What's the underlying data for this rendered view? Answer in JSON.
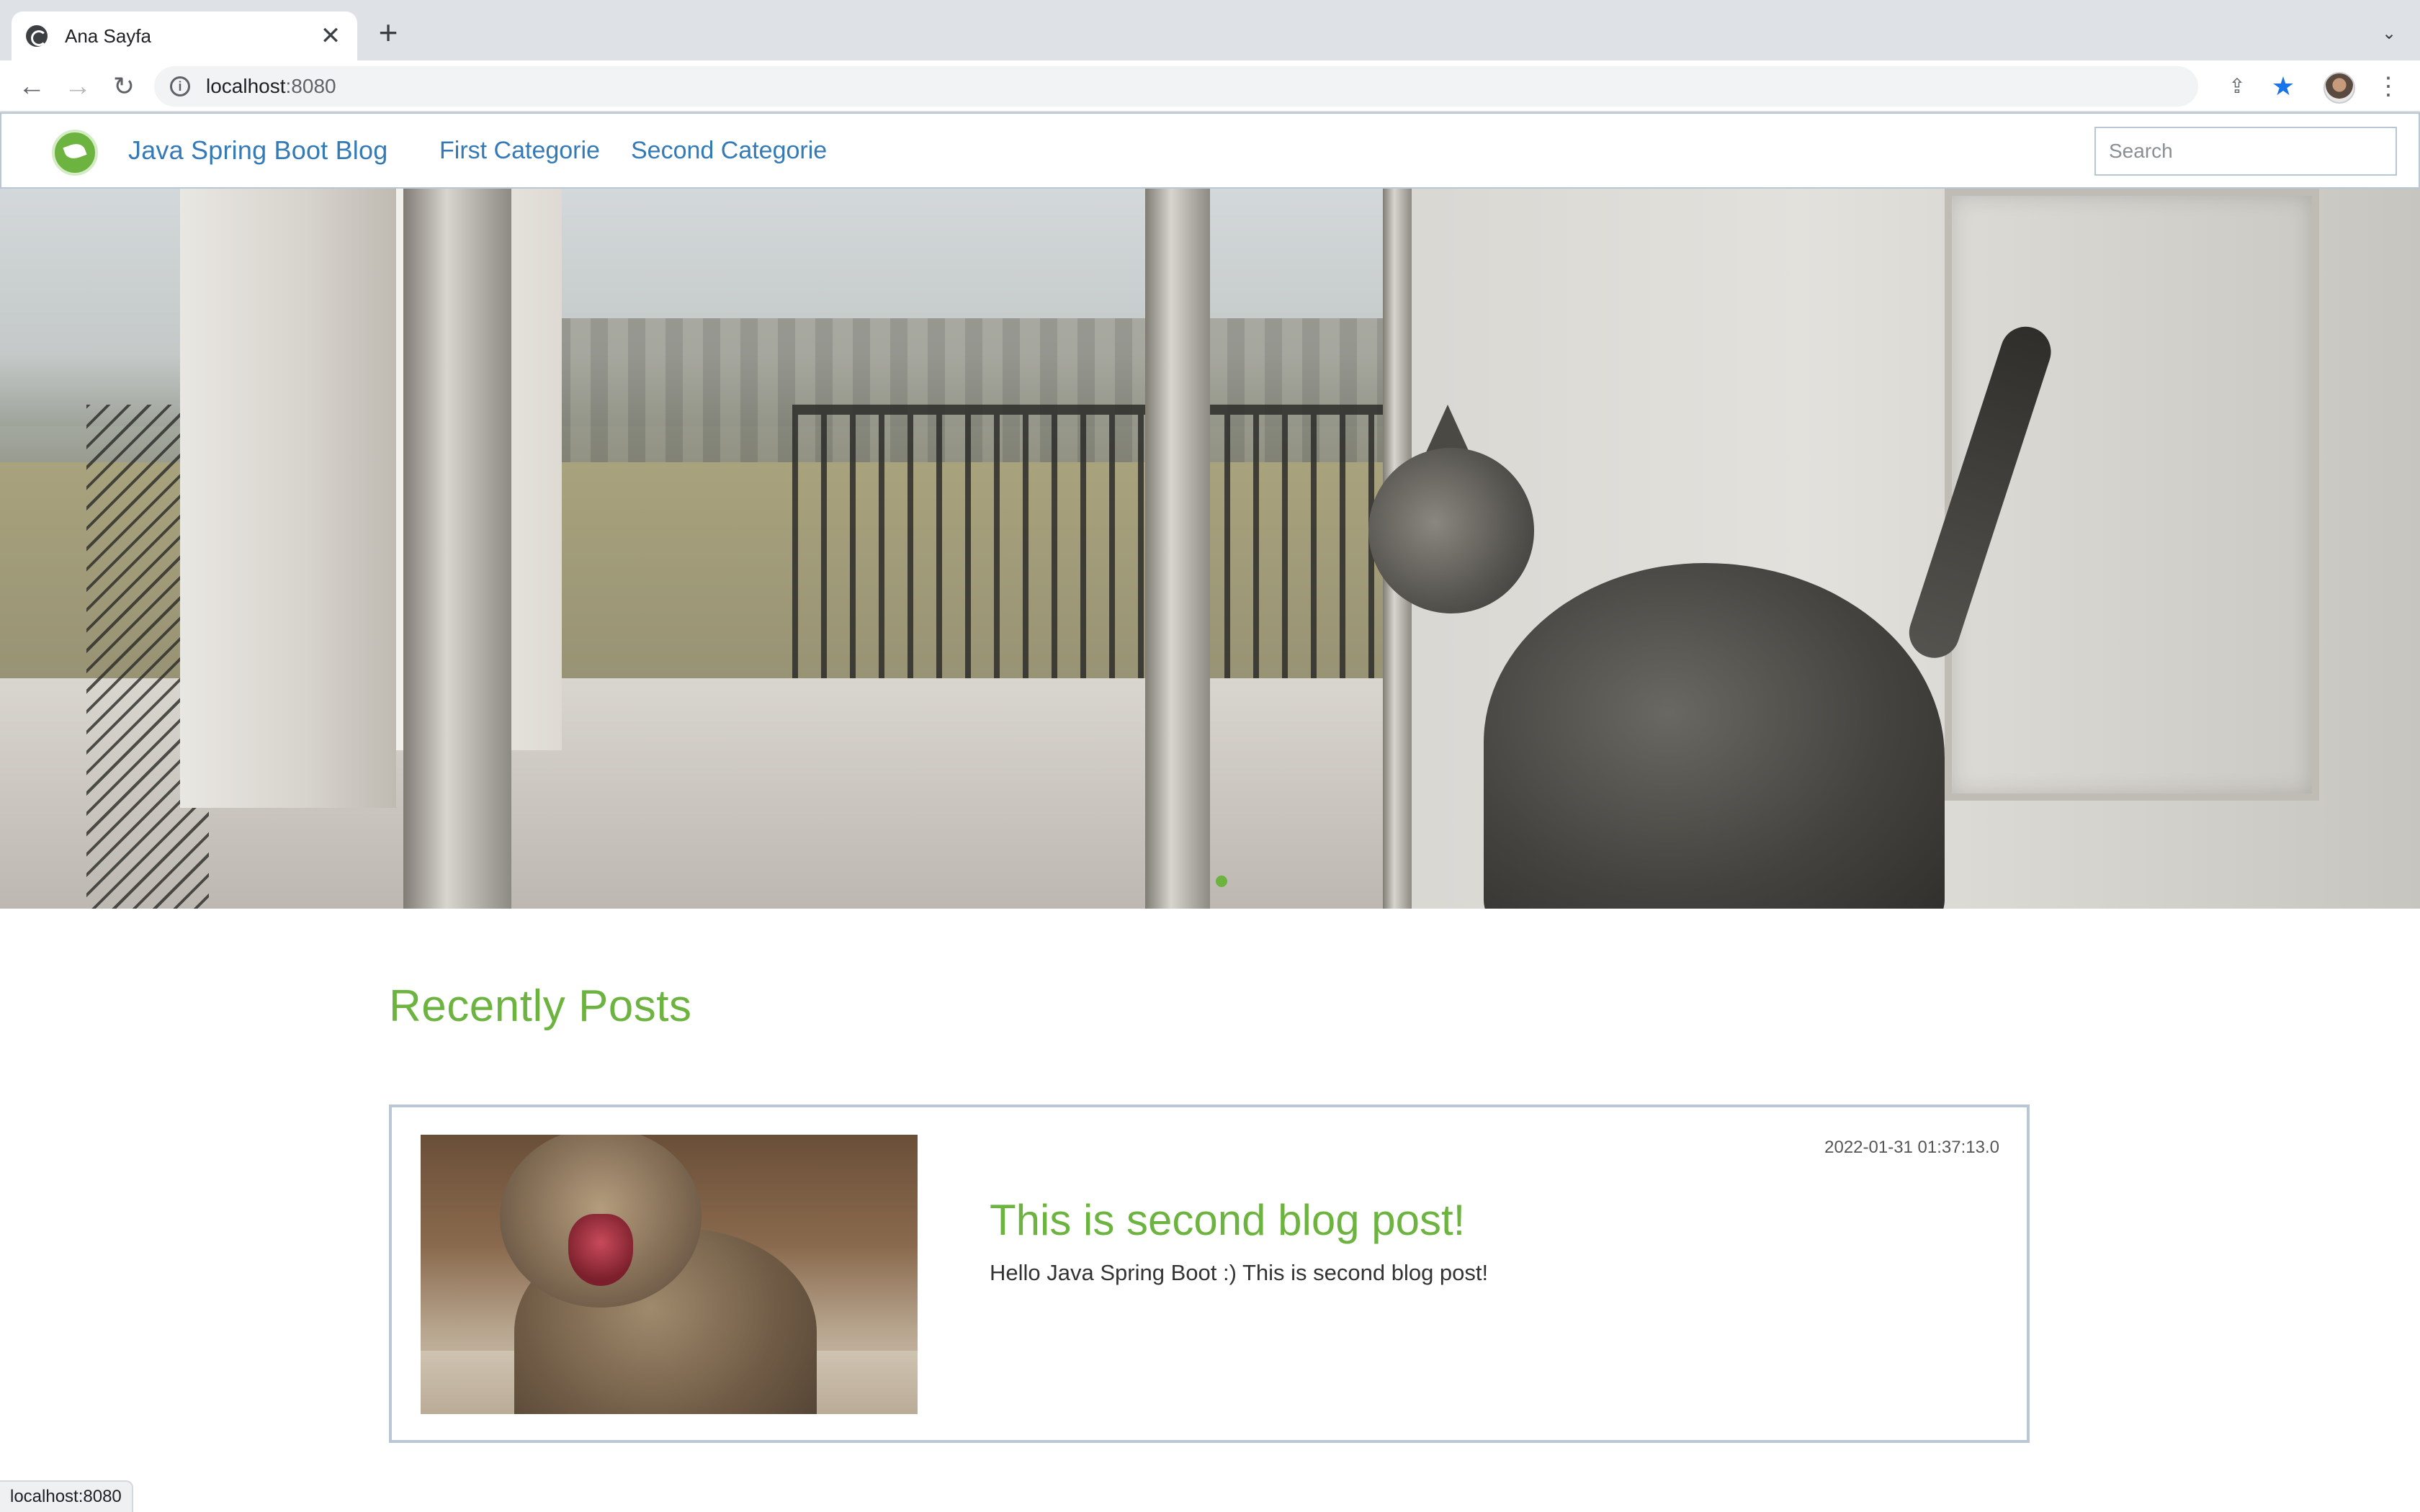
{
  "browser": {
    "tab": {
      "title": "Ana Sayfa",
      "close_glyph": "✕"
    },
    "new_tab_glyph": "+",
    "tab_list_glyph": "⌄",
    "address": {
      "host": "localhost",
      "port": ":8080"
    },
    "icons": {
      "back": "arrow-left-icon",
      "forward": "arrow-right-icon",
      "reload": "reload-icon",
      "site_info": "info-icon",
      "share": "share-icon",
      "bookmark": "star-icon",
      "menu": "kebab-menu-icon"
    },
    "status_bar_url": "localhost:8080"
  },
  "site": {
    "brand": "Java Spring Boot Blog",
    "nav": [
      {
        "label": "First Categorie"
      },
      {
        "label": "Second Categorie"
      }
    ],
    "search": {
      "placeholder": "Search",
      "value": ""
    },
    "colors": {
      "accent": "#6db33f",
      "link": "#337ab7",
      "border": "#b9c6d3"
    }
  },
  "main": {
    "section_title": "Recently Posts",
    "posts": [
      {
        "date": "2022-01-31 01:37:13.0",
        "title": "This is second blog post!",
        "excerpt": "Hello Java Spring Boot :) This is second blog post!"
      }
    ]
  }
}
